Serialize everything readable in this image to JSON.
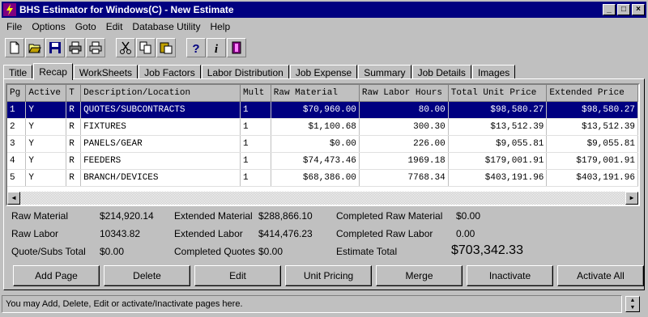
{
  "window": {
    "title": "BHS Estimator for Windows(C) - New Estimate"
  },
  "menu": [
    "File",
    "Options",
    "Goto",
    "Edit",
    "Database Utility",
    "Help"
  ],
  "tabs": [
    "Title",
    "Recap",
    "WorkSheets",
    "Job Factors",
    "Labor Distribution",
    "Job Expense",
    "Summary",
    "Job Details",
    "Images"
  ],
  "active_tab": "Recap",
  "grid": {
    "columns": [
      "Pg",
      "Active",
      "T",
      "Description/Location",
      "Mult",
      "Raw Material",
      "Raw Labor Hours",
      "Total Unit Price",
      "Extended Price"
    ],
    "rows": [
      [
        "1",
        "Y",
        "R",
        "QUOTES/SUBCONTRACTS",
        "1",
        "$70,960.00",
        "80.00",
        "$98,580.27",
        "$98,580.27"
      ],
      [
        "2",
        "Y",
        "R",
        "FIXTURES",
        "1",
        "$1,100.68",
        "300.30",
        "$13,512.39",
        "$13,512.39"
      ],
      [
        "3",
        "Y",
        "R",
        "PANELS/GEAR",
        "1",
        "$0.00",
        "226.00",
        "$9,055.81",
        "$9,055.81"
      ],
      [
        "4",
        "Y",
        "R",
        "FEEDERS",
        "1",
        "$74,473.46",
        "1969.18",
        "$179,001.91",
        "$179,001.91"
      ],
      [
        "5",
        "Y",
        "R",
        "BRANCH/DEVICES",
        "1",
        "$68,386.00",
        "7768.34",
        "$403,191.96",
        "$403,191.96"
      ]
    ]
  },
  "totals": {
    "raw_material_label": "Raw Material",
    "raw_material": "$214,920.14",
    "raw_labor_label": "Raw Labor",
    "raw_labor": "10343.82",
    "quote_subs_label": "Quote/Subs Total",
    "quote_subs": "$0.00",
    "ext_material_label": "Extended Material",
    "ext_material": "$288,866.10",
    "ext_labor_label": "Extended Labor",
    "ext_labor": "$414,476.23",
    "completed_quotes_label": "Completed Quotes",
    "completed_quotes": "$0.00",
    "comp_raw_material_label": "Completed Raw Material",
    "comp_raw_material": "$0.00",
    "comp_raw_labor_label": "Completed Raw Labor",
    "comp_raw_labor": "0.00",
    "estimate_total_label": "Estimate Total",
    "estimate_total": "$703,342.33"
  },
  "buttons": {
    "add_page": "Add Page",
    "delete": "Delete",
    "edit": "Edit",
    "unit_pricing": "Unit Pricing",
    "merge": "Merge",
    "inactivate": "Inactivate",
    "activate_all": "Activate All"
  },
  "status": "You may Add, Delete, Edit or activate/Inactivate pages here.",
  "colors": {
    "title_bar": "#000080",
    "selection": "#000080",
    "chrome": "#c0c0c0"
  }
}
